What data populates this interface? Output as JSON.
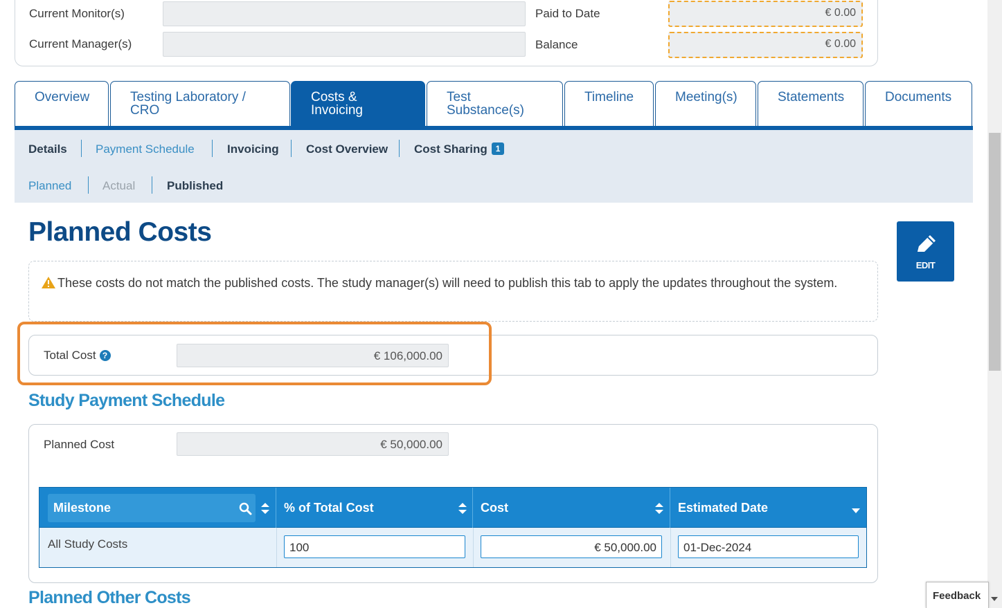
{
  "summary": {
    "current_monitors_label": "Current Monitor(s)",
    "current_managers_label": "Current Manager(s)",
    "paid_to_date_label": "Paid to Date",
    "paid_to_date_value": "€ 0.00",
    "balance_label": "Balance",
    "balance_value": "€ 0.00"
  },
  "tabs": [
    {
      "line1": "Overview",
      "line2": ""
    },
    {
      "line1": "Testing Laboratory /",
      "line2": "CRO"
    },
    {
      "line1": "Costs &",
      "line2": "Invoicing"
    },
    {
      "line1": "Test",
      "line2": "Substance(s)"
    },
    {
      "line1": "Timeline",
      "line2": ""
    },
    {
      "line1": "Meeting(s)",
      "line2": ""
    },
    {
      "line1": "Statements",
      "line2": ""
    },
    {
      "line1": "Documents",
      "line2": ""
    }
  ],
  "subnav": {
    "items": [
      "Details",
      "Payment Schedule",
      "Invoicing",
      "Cost Overview",
      "Cost Sharing"
    ],
    "cost_sharing_badge": "1",
    "views": [
      "Planned",
      "Actual",
      "Published"
    ]
  },
  "page_title": "Planned Costs",
  "edit_label": "EDIT",
  "warning_text": "These costs do not match the published costs. The study manager(s) will need to publish this tab to apply the updates throughout the system.",
  "total_cost": {
    "label": "Total Cost",
    "help": "?",
    "value": "€ 106,000.00"
  },
  "study_payment_schedule": {
    "title": "Study Payment Schedule",
    "planned_cost_label": "Planned Cost",
    "planned_cost_value": "€ 50,000.00",
    "columns": [
      "Milestone",
      "% of Total Cost",
      "Cost",
      "Estimated Date"
    ],
    "rows": [
      {
        "milestone": "All Study Costs",
        "percent": "100",
        "cost": "€ 50,000.00",
        "date": "01-Dec-2024"
      }
    ]
  },
  "planned_other_costs_title": "Planned Other Costs",
  "feedback_label": "Feedback",
  "colors": {
    "primary": "#0b5ea8",
    "table_header": "#1a86cf",
    "highlight": "#ea8a35",
    "dashed_money": "#f0a830"
  }
}
